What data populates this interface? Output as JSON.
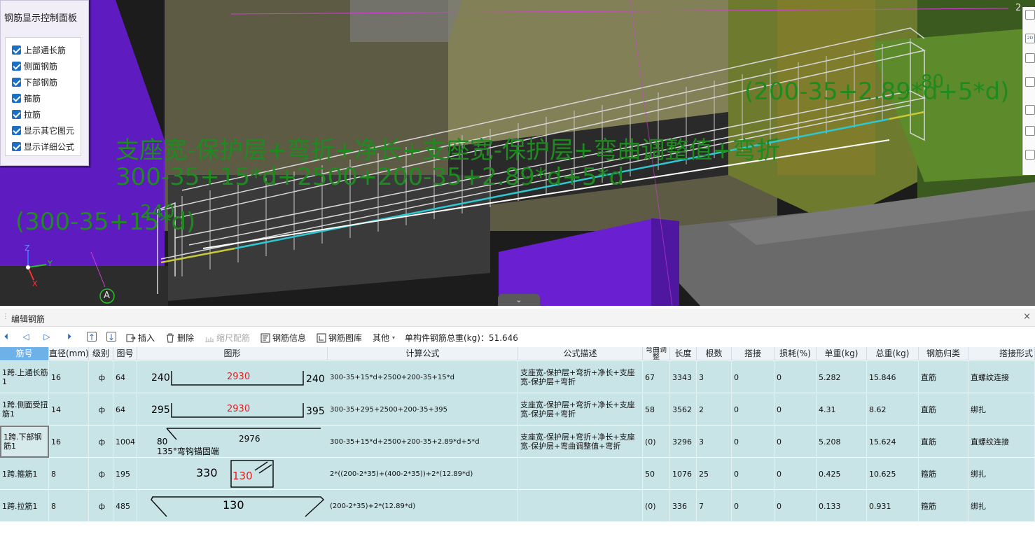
{
  "control_panel": {
    "title": "钢筋显示控制面板",
    "items": [
      {
        "label": "上部通长筋",
        "checked": true
      },
      {
        "label": "侧面钢筋",
        "checked": true
      },
      {
        "label": "下部钢筋",
        "checked": true
      },
      {
        "label": "箍筋",
        "checked": true
      },
      {
        "label": "拉筋",
        "checked": true
      },
      {
        "label": "显示其它图元",
        "checked": true
      },
      {
        "label": "显示详细公式",
        "checked": true
      }
    ]
  },
  "viewport": {
    "formula_line1": "支座宽-保护层+弯折+净长+支座宽-保护层+弯曲调整值+弯折",
    "formula_line2": "300-35+15*d+2500+200-35+2.89*d+5*d",
    "left_formula": "(300-35+15*d)",
    "left_value": "240",
    "right_formula": "(200-35+2.89*d+5*d)",
    "right_value": "80",
    "axis_z": "Z",
    "axis_y": "Y",
    "axis_x": "X",
    "grid_label": "A",
    "corner_label": "2",
    "collapse_icon": "chevron-down",
    "right_toolbar": [
      "2D",
      "",
      "",
      "",
      "",
      "",
      ""
    ]
  },
  "editor": {
    "title": "编辑钢筋",
    "close": "×",
    "toolbar": {
      "insert": "插入",
      "delete": "删除",
      "scale": "缩尺配筋",
      "info": "钢筋信息",
      "library": "钢筋图库",
      "other": "其他",
      "total_label": "单构件钢筋总重(kg)：51.646"
    },
    "columns": [
      "筋号",
      "直径(mm)",
      "级别",
      "图号",
      "图形",
      "计算公式",
      "公式描述",
      "弯曲调整",
      "长度",
      "根数",
      "搭接",
      "损耗(%)",
      "单重(kg)",
      "总重(kg)",
      "钢筋归类",
      "搭接形式"
    ],
    "rows": [
      {
        "name": "1跨.上通长筋1",
        "dia": "16",
        "grade": "ф",
        "fig": "64",
        "shape": {
          "left": "240",
          "mid": "2930",
          "right": "240"
        },
        "formula": "300-35+15*d+2500+200-35+15*d",
        "desc": "支座宽-保护层+弯折+净长+支座宽-保护层+弯折",
        "bend": "67",
        "length": "3343",
        "count": "3",
        "lap": "0",
        "loss": "0",
        "unit_w": "5.282",
        "total_w": "15.846",
        "cat": "直筋",
        "lap_type": "直螺纹连接"
      },
      {
        "name": "1跨.侧面受扭筋1",
        "dia": "14",
        "grade": "ф",
        "fig": "64",
        "shape": {
          "left": "295",
          "mid": "2930",
          "right": "395"
        },
        "formula": "300-35+295+2500+200-35+395",
        "desc": "支座宽-保护层+弯折+净长+支座宽-保护层+弯折",
        "bend": "58",
        "length": "3562",
        "count": "2",
        "lap": "0",
        "loss": "0",
        "unit_w": "4.31",
        "total_w": "8.62",
        "cat": "直筋",
        "lap_type": "绑扎"
      },
      {
        "name": "1跨.下部钢筋1",
        "dia": "16",
        "grade": "ф",
        "fig": "1004",
        "shape": {
          "left": "80",
          "mid": "2976",
          "note": "135°弯钩锚固端"
        },
        "formula": "300-35+15*d+2500+200-35+2.89*d+5*d",
        "desc": "支座宽-保护层+弯折+净长+支座宽-保护层+弯曲调整值+弯折",
        "bend": "(0)",
        "length": "3296",
        "count": "3",
        "lap": "0",
        "loss": "0",
        "unit_w": "5.208",
        "total_w": "15.624",
        "cat": "直筋",
        "lap_type": "直螺纹连接"
      },
      {
        "name": "1跨.箍筋1",
        "dia": "8",
        "grade": "ф",
        "fig": "195",
        "shape": {
          "left": "330",
          "mid": "130"
        },
        "formula": "2*((200-2*35)+(400-2*35))+2*(12.89*d)",
        "desc": "",
        "bend": "50",
        "length": "1076",
        "count": "25",
        "lap": "0",
        "loss": "0",
        "unit_w": "0.425",
        "total_w": "10.625",
        "cat": "箍筋",
        "lap_type": "绑扎"
      },
      {
        "name": "1跨.拉筋1",
        "dia": "8",
        "grade": "ф",
        "fig": "485",
        "shape": {
          "mid": "130"
        },
        "formula": "(200-2*35)+2*(12.89*d)",
        "desc": "",
        "bend": "(0)",
        "length": "336",
        "count": "7",
        "lap": "0",
        "loss": "0",
        "unit_w": "0.133",
        "total_w": "0.931",
        "cat": "箍筋",
        "lap_type": "绑扎"
      }
    ]
  },
  "colors": {
    "dim_green": "#1f8a1f",
    "purple": "#6a1fd1",
    "row_bg": "#c9e4e6",
    "red_dim": "#e02020",
    "selected_header": "#6eb1e8"
  }
}
